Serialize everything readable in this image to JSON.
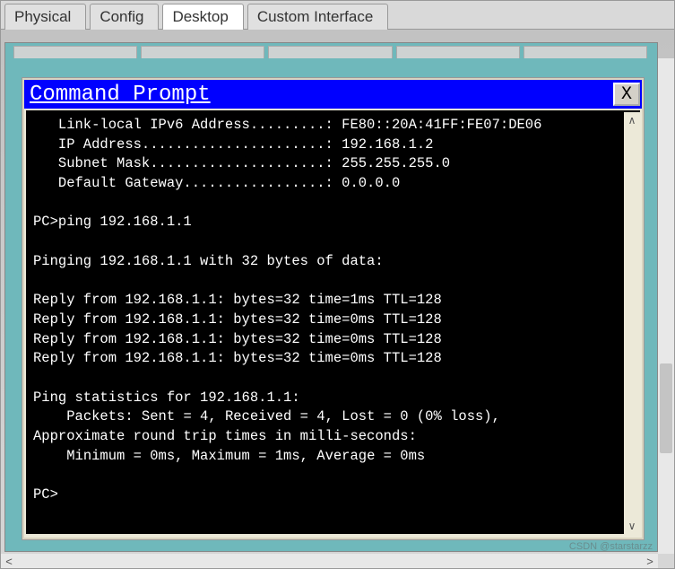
{
  "tabs": [
    {
      "label": "Physical",
      "active": false
    },
    {
      "label": "Config",
      "active": false
    },
    {
      "label": "Desktop",
      "active": true
    },
    {
      "label": "Custom Interface",
      "active": false
    }
  ],
  "cmd": {
    "title": "Command Prompt",
    "close_label": "X",
    "lines": "   Link-local IPv6 Address.........: FE80::20A:41FF:FE07:DE06\n   IP Address......................: 192.168.1.2\n   Subnet Mask.....................: 255.255.255.0\n   Default Gateway.................: 0.0.0.0\n\nPC>ping 192.168.1.1\n\nPinging 192.168.1.1 with 32 bytes of data:\n\nReply from 192.168.1.1: bytes=32 time=1ms TTL=128\nReply from 192.168.1.1: bytes=32 time=0ms TTL=128\nReply from 192.168.1.1: bytes=32 time=0ms TTL=128\nReply from 192.168.1.1: bytes=32 time=0ms TTL=128\n\nPing statistics for 192.168.1.1:\n    Packets: Sent = 4, Received = 4, Lost = 0 (0% loss),\nApproximate round trip times in milli-seconds:\n    Minimum = 0ms, Maximum = 1ms, Average = 0ms\n\nPC>"
  },
  "scroll": {
    "up": "∧",
    "down": "∨",
    "left": "<",
    "right": ">"
  },
  "watermark": "CSDN @starstarzz"
}
